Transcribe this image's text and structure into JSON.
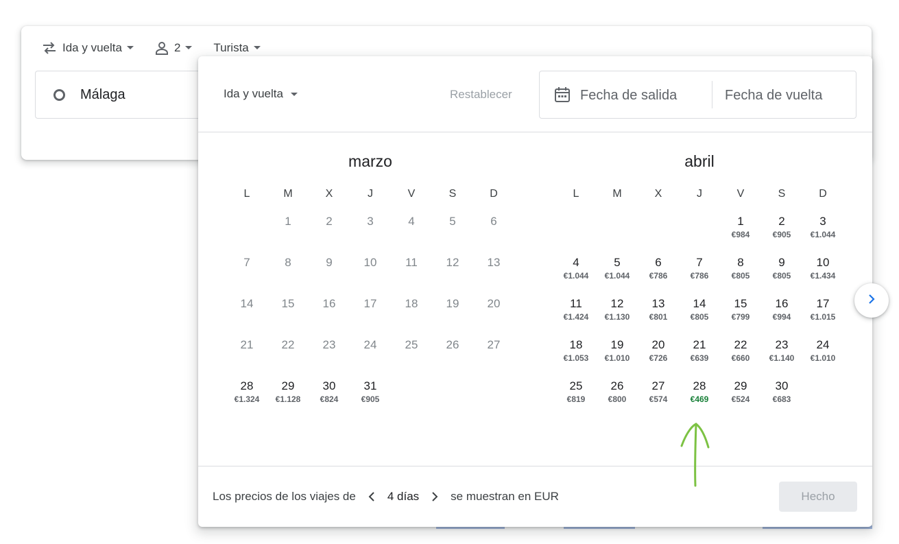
{
  "search": {
    "trip_type": "Ida y vuelta",
    "passengers": "2",
    "cabin": "Turista",
    "origin": "Málaga"
  },
  "popup": {
    "trip_type": "Ida y vuelta",
    "reset": "Restablecer",
    "departure_placeholder": "Fecha de salida",
    "return_placeholder": "Fecha de vuelta"
  },
  "weekdays": [
    "L",
    "M",
    "X",
    "J",
    "V",
    "S",
    "D"
  ],
  "months": [
    {
      "name": "marzo",
      "offset": 1,
      "days": [
        {
          "d": "1",
          "past": true
        },
        {
          "d": "2",
          "past": true
        },
        {
          "d": "3",
          "past": true
        },
        {
          "d": "4",
          "past": true
        },
        {
          "d": "5",
          "past": true
        },
        {
          "d": "6",
          "past": true
        },
        {
          "d": "7",
          "past": true
        },
        {
          "d": "8",
          "past": true
        },
        {
          "d": "9",
          "past": true
        },
        {
          "d": "10",
          "past": true
        },
        {
          "d": "11",
          "past": true
        },
        {
          "d": "12",
          "past": true
        },
        {
          "d": "13",
          "past": true
        },
        {
          "d": "14",
          "past": true
        },
        {
          "d": "15",
          "past": true
        },
        {
          "d": "16",
          "past": true
        },
        {
          "d": "17",
          "past": true
        },
        {
          "d": "18",
          "past": true
        },
        {
          "d": "19",
          "past": true
        },
        {
          "d": "20",
          "past": true
        },
        {
          "d": "21",
          "past": true
        },
        {
          "d": "22",
          "past": true
        },
        {
          "d": "23",
          "past": true
        },
        {
          "d": "24",
          "past": true
        },
        {
          "d": "25",
          "past": true
        },
        {
          "d": "26",
          "past": true
        },
        {
          "d": "27",
          "past": true
        },
        {
          "d": "28",
          "p": "€1.324"
        },
        {
          "d": "29",
          "p": "€1.128"
        },
        {
          "d": "30",
          "p": "€824"
        },
        {
          "d": "31",
          "p": "€905"
        }
      ]
    },
    {
      "name": "abril",
      "offset": 4,
      "days": [
        {
          "d": "1",
          "p": "€984"
        },
        {
          "d": "2",
          "p": "€905"
        },
        {
          "d": "3",
          "p": "€1.044"
        },
        {
          "d": "4",
          "p": "€1.044"
        },
        {
          "d": "5",
          "p": "€1.044"
        },
        {
          "d": "6",
          "p": "€786"
        },
        {
          "d": "7",
          "p": "€786"
        },
        {
          "d": "8",
          "p": "€805"
        },
        {
          "d": "9",
          "p": "€805"
        },
        {
          "d": "10",
          "p": "€1.434"
        },
        {
          "d": "11",
          "p": "€1.424"
        },
        {
          "d": "12",
          "p": "€1.130"
        },
        {
          "d": "13",
          "p": "€801"
        },
        {
          "d": "14",
          "p": "€805"
        },
        {
          "d": "15",
          "p": "€799"
        },
        {
          "d": "16",
          "p": "€994"
        },
        {
          "d": "17",
          "p": "€1.015"
        },
        {
          "d": "18",
          "p": "€1.053"
        },
        {
          "d": "19",
          "p": "€1.010"
        },
        {
          "d": "20",
          "p": "€726"
        },
        {
          "d": "21",
          "p": "€639"
        },
        {
          "d": "22",
          "p": "€660"
        },
        {
          "d": "23",
          "p": "€1.140"
        },
        {
          "d": "24",
          "p": "€1.010"
        },
        {
          "d": "25",
          "p": "€819"
        },
        {
          "d": "26",
          "p": "€800"
        },
        {
          "d": "27",
          "p": "€574"
        },
        {
          "d": "28",
          "p": "€469",
          "low": true
        },
        {
          "d": "29",
          "p": "€524"
        },
        {
          "d": "30",
          "p": "€683"
        }
      ]
    }
  ],
  "footer": {
    "prefix": "Los precios de los viajes de",
    "duration": "4 días",
    "suffix": "se muestran en EUR",
    "done": "Hecho"
  },
  "colors": {
    "low_price": "#188038",
    "annotation": "#7cc243"
  },
  "icons": {
    "trip": "swap-arrows-icon",
    "person": "person-icon",
    "calendar": "calendar-icon",
    "next": "chevron-right-icon"
  }
}
